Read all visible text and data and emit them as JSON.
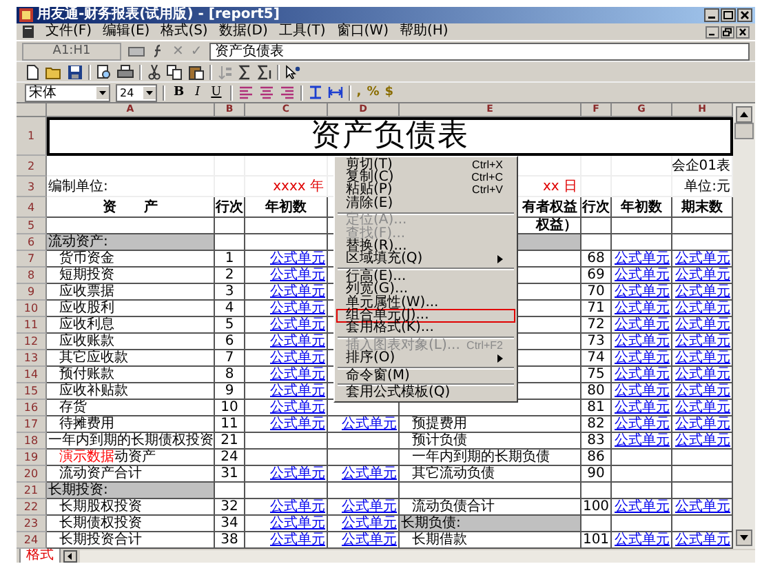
{
  "window": {
    "title": "用友通-财务报表(试用版) - [report5]"
  },
  "menu_bar": [
    "文件(F)",
    "编辑(E)",
    "格式(S)",
    "数据(D)",
    "工具(T)",
    "窗口(W)",
    "帮助(H)"
  ],
  "formula_bar": {
    "cell_ref": "A1:H1",
    "cancel": "✕",
    "confirm": "✓",
    "value": "资产负债表"
  },
  "format_toolbar": {
    "font": "宋体",
    "size": "24",
    "style_buttons": [
      "B",
      "I",
      "U"
    ],
    "number_buttons": [
      ",",
      "%",
      "$"
    ]
  },
  "sheet": {
    "columns": [
      "A",
      "B",
      "C",
      "D",
      "E",
      "F",
      "G",
      "H"
    ],
    "rows": [
      {
        "num": "1",
        "title": "资产负债表"
      },
      {
        "num": "2",
        "cells": [
          null,
          null,
          null,
          null,
          null,
          null,
          null,
          {
            "text": "会企01表",
            "kind": "note"
          }
        ]
      },
      {
        "num": "3",
        "cells": [
          {
            "text": "编制单位:",
            "kind": "label"
          },
          null,
          {
            "text": "xxxx 年",
            "kind": "red"
          },
          null,
          {
            "text": "xx 日",
            "kind": "red"
          },
          null,
          null,
          {
            "text": "单位:元",
            "kind": "note"
          }
        ]
      },
      {
        "num": "4",
        "cells": [
          {
            "text": "资　　产",
            "kind": "header"
          },
          {
            "text": "行次",
            "kind": "header"
          },
          {
            "text": "年初数",
            "kind": "header"
          },
          null,
          {
            "text": "有者权益",
            "kind": "header_right"
          },
          {
            "text": "行次",
            "kind": "header"
          },
          {
            "text": "年初数",
            "kind": "header"
          },
          {
            "text": "期末数",
            "kind": "header"
          }
        ]
      },
      {
        "num": "5",
        "cells": [
          null,
          null,
          null,
          null,
          {
            "text": "权益）",
            "kind": "header_right"
          },
          null,
          null,
          null
        ]
      },
      {
        "num": "6",
        "cells": [
          {
            "text": "流动资产:",
            "kind": "section"
          },
          null,
          null,
          null,
          {
            "kind": "section"
          },
          null,
          null,
          null
        ]
      },
      {
        "num": "7",
        "cells": [
          {
            "text": "货币资金",
            "kind": "item"
          },
          {
            "text": "1",
            "kind": "num"
          },
          {
            "text": "公式单元",
            "kind": "formula"
          },
          null,
          null,
          {
            "text": "68",
            "kind": "num"
          },
          {
            "text": "公式单元",
            "kind": "formula"
          },
          {
            "text": "公式单元",
            "kind": "formula"
          }
        ]
      },
      {
        "num": "8",
        "cells": [
          {
            "text": "短期投资",
            "kind": "item"
          },
          {
            "text": "2",
            "kind": "num"
          },
          {
            "text": "公式单元",
            "kind": "formula"
          },
          null,
          null,
          {
            "text": "69",
            "kind": "num"
          },
          {
            "text": "公式单元",
            "kind": "formula"
          },
          {
            "text": "公式单元",
            "kind": "formula"
          }
        ]
      },
      {
        "num": "9",
        "cells": [
          {
            "text": "应收票据",
            "kind": "item"
          },
          {
            "text": "3",
            "kind": "num"
          },
          {
            "text": "公式单元",
            "kind": "formula"
          },
          null,
          null,
          {
            "text": "70",
            "kind": "num"
          },
          {
            "text": "公式单元",
            "kind": "formula"
          },
          {
            "text": "公式单元",
            "kind": "formula"
          }
        ]
      },
      {
        "num": "10",
        "cells": [
          {
            "text": "应收股利",
            "kind": "item"
          },
          {
            "text": "4",
            "kind": "num"
          },
          {
            "text": "公式单元",
            "kind": "formula"
          },
          null,
          null,
          {
            "text": "71",
            "kind": "num"
          },
          {
            "text": "公式单元",
            "kind": "formula"
          },
          {
            "text": "公式单元",
            "kind": "formula"
          }
        ]
      },
      {
        "num": "11",
        "cells": [
          {
            "text": "应收利息",
            "kind": "item"
          },
          {
            "text": "5",
            "kind": "num"
          },
          {
            "text": "公式单元",
            "kind": "formula"
          },
          null,
          null,
          {
            "text": "72",
            "kind": "num"
          },
          {
            "text": "公式单元",
            "kind": "formula"
          },
          {
            "text": "公式单元",
            "kind": "formula"
          }
        ]
      },
      {
        "num": "12",
        "cells": [
          {
            "text": "应收账款",
            "kind": "item"
          },
          {
            "text": "6",
            "kind": "num"
          },
          {
            "text": "公式单元",
            "kind": "formula"
          },
          null,
          null,
          {
            "text": "73",
            "kind": "num"
          },
          {
            "text": "公式单元",
            "kind": "formula"
          },
          {
            "text": "公式单元",
            "kind": "formula"
          }
        ]
      },
      {
        "num": "13",
        "cells": [
          {
            "text": "其它应收款",
            "kind": "item"
          },
          {
            "text": "7",
            "kind": "num"
          },
          {
            "text": "公式单元",
            "kind": "formula"
          },
          null,
          null,
          {
            "text": "74",
            "kind": "num"
          },
          {
            "text": "公式单元",
            "kind": "formula"
          },
          {
            "text": "公式单元",
            "kind": "formula"
          }
        ]
      },
      {
        "num": "14",
        "cells": [
          {
            "text": "预付账款",
            "kind": "item"
          },
          {
            "text": "8",
            "kind": "num"
          },
          {
            "text": "公式单元",
            "kind": "formula"
          },
          null,
          null,
          {
            "text": "75",
            "kind": "num"
          },
          {
            "text": "公式单元",
            "kind": "formula"
          },
          {
            "text": "公式单元",
            "kind": "formula"
          }
        ]
      },
      {
        "num": "15",
        "cells": [
          {
            "text": "应收补贴款",
            "kind": "item"
          },
          {
            "text": "9",
            "kind": "num"
          },
          {
            "text": "公式单元",
            "kind": "formula"
          },
          null,
          null,
          {
            "text": "80",
            "kind": "num"
          },
          {
            "text": "公式单元",
            "kind": "formula"
          },
          {
            "text": "公式单元",
            "kind": "formula"
          }
        ]
      },
      {
        "num": "16",
        "cells": [
          {
            "text": "存货",
            "kind": "item"
          },
          {
            "text": "10",
            "kind": "num"
          },
          {
            "text": "公式单元",
            "kind": "formula"
          },
          null,
          null,
          {
            "text": "81",
            "kind": "num"
          },
          {
            "text": "公式单元",
            "kind": "formula"
          },
          {
            "text": "公式单元",
            "kind": "formula"
          }
        ]
      },
      {
        "num": "17",
        "cells": [
          {
            "text": "待摊费用",
            "kind": "item"
          },
          {
            "text": "11",
            "kind": "num"
          },
          {
            "text": "公式单元",
            "kind": "formula"
          },
          {
            "text": "公式单元",
            "kind": "formula"
          },
          {
            "text": "预提费用",
            "kind": "item"
          },
          {
            "text": "82",
            "kind": "num"
          },
          {
            "text": "公式单元",
            "kind": "formula"
          },
          {
            "text": "公式单元",
            "kind": "formula"
          }
        ]
      },
      {
        "num": "18",
        "cells": [
          {
            "text": "一年内到期的长期债权投资",
            "kind": "label"
          },
          {
            "text": "21",
            "kind": "num"
          },
          null,
          null,
          {
            "text": "预计负债",
            "kind": "item"
          },
          {
            "text": "83",
            "kind": "num"
          },
          {
            "text": "公式单元",
            "kind": "formula"
          },
          {
            "text": "公式单元",
            "kind": "formula"
          }
        ]
      },
      {
        "num": "19",
        "cells": [
          {
            "text": "动资产",
            "kind": "item",
            "stamp": "演示数据"
          },
          {
            "text": "24",
            "kind": "num"
          },
          null,
          null,
          {
            "text": "一年内到期的长期负债",
            "kind": "item"
          },
          {
            "text": "86",
            "kind": "num"
          },
          null,
          null
        ]
      },
      {
        "num": "20",
        "cells": [
          {
            "text": "流动资产合计",
            "kind": "item"
          },
          {
            "text": "31",
            "kind": "num"
          },
          {
            "text": "公式单元",
            "kind": "formula"
          },
          {
            "text": "公式单元",
            "kind": "formula"
          },
          {
            "text": "其它流动负债",
            "kind": "item"
          },
          {
            "text": "90",
            "kind": "num"
          },
          null,
          null
        ]
      },
      {
        "num": "21",
        "cells": [
          {
            "text": "长期投资:",
            "kind": "section"
          },
          null,
          null,
          null,
          null,
          null,
          null,
          null
        ]
      },
      {
        "num": "22",
        "cells": [
          {
            "text": "长期股权投资",
            "kind": "item"
          },
          {
            "text": "32",
            "kind": "num"
          },
          {
            "text": "公式单元",
            "kind": "formula"
          },
          {
            "text": "公式单元",
            "kind": "formula"
          },
          {
            "text": "流动负债合计",
            "kind": "item"
          },
          {
            "text": "100",
            "kind": "num"
          },
          {
            "text": "公式单元",
            "kind": "formula"
          },
          {
            "text": "公式单元",
            "kind": "formula"
          }
        ]
      },
      {
        "num": "23",
        "cells": [
          {
            "text": "长期债权投资",
            "kind": "item"
          },
          {
            "text": "34",
            "kind": "num"
          },
          {
            "text": "公式单元",
            "kind": "formula"
          },
          {
            "text": "公式单元",
            "kind": "formula"
          },
          {
            "text": "长期负债:",
            "kind": "section"
          },
          null,
          null,
          null
        ]
      },
      {
        "num": "24",
        "cells": [
          {
            "text": "长期投资合计",
            "kind": "item"
          },
          {
            "text": "38",
            "kind": "num"
          },
          {
            "text": "公式单元",
            "kind": "formula"
          },
          {
            "text": "公式单元",
            "kind": "formula"
          },
          {
            "text": "长期借款",
            "kind": "item"
          },
          {
            "text": "101",
            "kind": "num"
          },
          {
            "text": "公式单元",
            "kind": "formula"
          },
          {
            "text": "公式单元",
            "kind": "formula"
          }
        ]
      }
    ]
  },
  "context_menu": {
    "groups": [
      [
        {
          "label": "剪切(T)",
          "shortcut": "Ctrl+X",
          "disabled": false,
          "submenu": false,
          "highlighted": false
        },
        {
          "label": "复制(C)",
          "shortcut": "Ctrl+C",
          "disabled": false,
          "submenu": false,
          "highlighted": false
        },
        {
          "label": "粘贴(P)",
          "shortcut": "Ctrl+V",
          "disabled": false,
          "submenu": false,
          "highlighted": false
        },
        {
          "label": "清除(E)",
          "disabled": false,
          "submenu": false,
          "highlighted": false
        }
      ],
      [
        {
          "label": "定位(A)...",
          "disabled": true,
          "submenu": false,
          "highlighted": false
        },
        {
          "label": "查找(F)...",
          "disabled": true,
          "submenu": false,
          "highlighted": false
        },
        {
          "label": "替换(R)...",
          "disabled": false,
          "submenu": false,
          "highlighted": false
        },
        {
          "label": "区域填充(Q)",
          "disabled": false,
          "submenu": true,
          "highlighted": false
        }
      ],
      [
        {
          "label": "行高(E)...",
          "disabled": false,
          "submenu": false,
          "highlighted": false
        },
        {
          "label": "列宽(G)...",
          "disabled": false,
          "submenu": false,
          "highlighted": false
        },
        {
          "label": "单元属性(W)...",
          "disabled": false,
          "submenu": false,
          "highlighted": false
        },
        {
          "label": "组合单元(J)...",
          "disabled": false,
          "submenu": false,
          "highlighted": true
        },
        {
          "label": "套用格式(K)...",
          "disabled": false,
          "submenu": false,
          "highlighted": false
        }
      ],
      [
        {
          "label": "插入图表对象(L)...",
          "shortcut": "Ctrl+F2",
          "disabled": true,
          "submenu": false,
          "highlighted": false
        },
        {
          "label": "排序(O)",
          "disabled": false,
          "submenu": true,
          "highlighted": false
        }
      ],
      [
        {
          "label": "命令窗(M)",
          "disabled": false,
          "submenu": false,
          "highlighted": false
        }
      ],
      [
        {
          "label": "套用公式模板(Q)",
          "disabled": false,
          "submenu": false,
          "highlighted": false
        }
      ]
    ]
  },
  "sheet_tabs": [
    {
      "label": "格式",
      "selected": true
    }
  ]
}
